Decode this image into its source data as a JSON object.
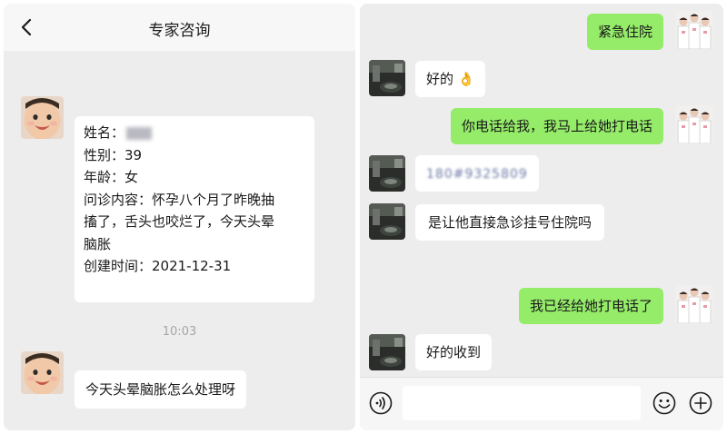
{
  "left": {
    "title": "专家咨询",
    "info": {
      "name_label": "姓名：",
      "gender": "性别：39",
      "age": "年龄：女",
      "question_line1": "问诊内容：怀孕八个月了昨晚抽",
      "question_line2": "搐了，舌头也咬烂了，今天头晕",
      "question_line3": "脑胀",
      "created": "创建时间：2021-12-31"
    },
    "timestamp": "10:03",
    "message": "今天头晕脑胀怎么处理呀"
  },
  "right": {
    "messages": [
      {
        "from": "me",
        "text": "紧急住院"
      },
      {
        "from": "other",
        "text": "好的 👌"
      },
      {
        "from": "me",
        "text": "你电话给我，我马上给她打电话"
      },
      {
        "from": "other",
        "text": "180#9325809"
      },
      {
        "from": "other",
        "text": "是让他直接急诊挂号住院吗"
      },
      {
        "from": "me",
        "text": "我已经给她打电话了"
      },
      {
        "from": "other",
        "text": "好的收到"
      }
    ],
    "input": {
      "value": ""
    }
  },
  "colors": {
    "bg": "#ededed",
    "my_bubble": "#95ec69",
    "their_bubble": "#ffffff"
  },
  "icons": [
    "back-icon",
    "voice-icon",
    "emoji-icon",
    "plus-icon"
  ]
}
